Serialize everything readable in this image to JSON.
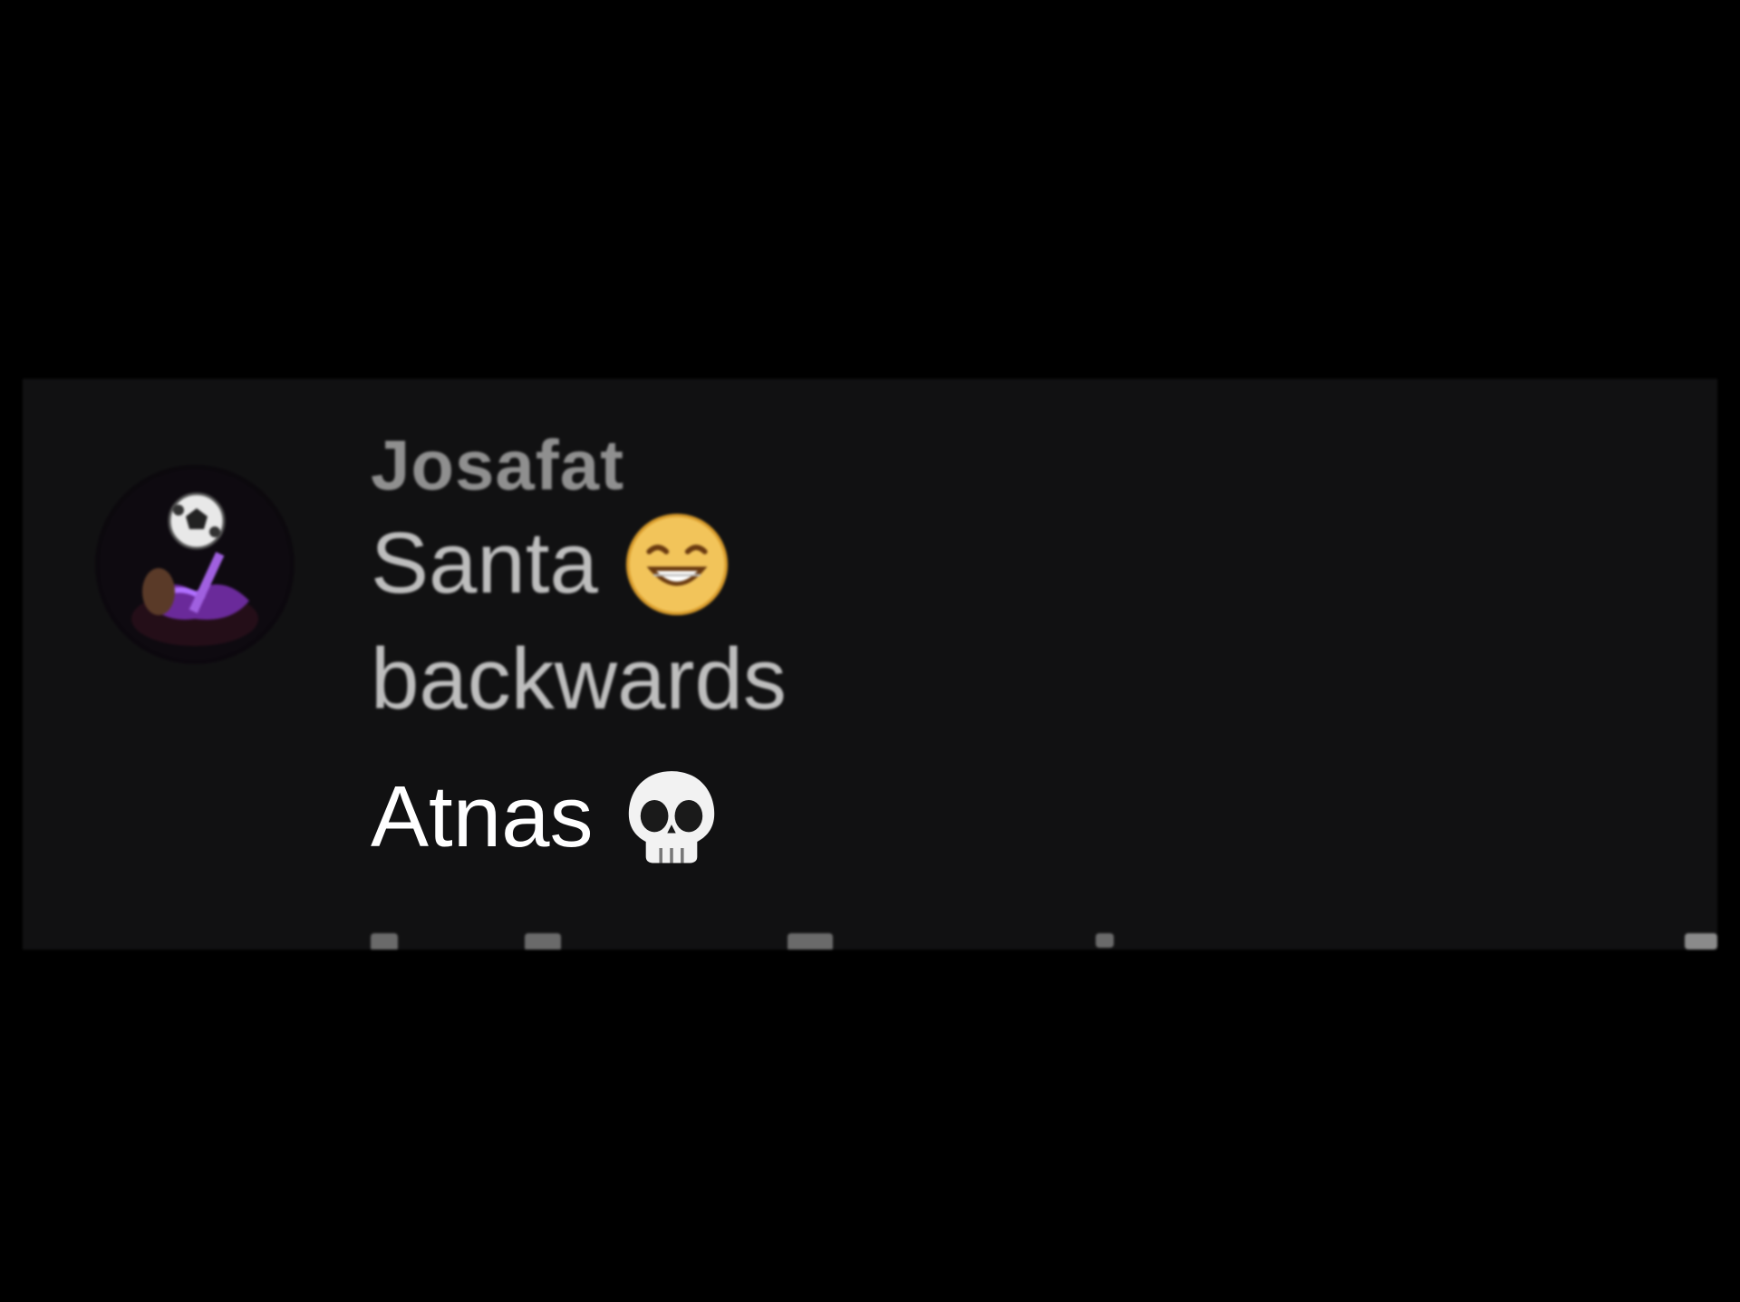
{
  "comment": {
    "author": "Josafat",
    "lines": [
      "Santa",
      "backwards"
    ],
    "reply_line": "Atnas",
    "icons": {
      "avatar": "avatar-image",
      "grin": "grinning-face-icon",
      "skull": "skull-icon"
    }
  },
  "colors": {
    "background": "#000000",
    "card": "#111112",
    "author_text": "#8f8f8f",
    "body_text": "#bdbdbd",
    "overlay_text": "#ffffff"
  }
}
